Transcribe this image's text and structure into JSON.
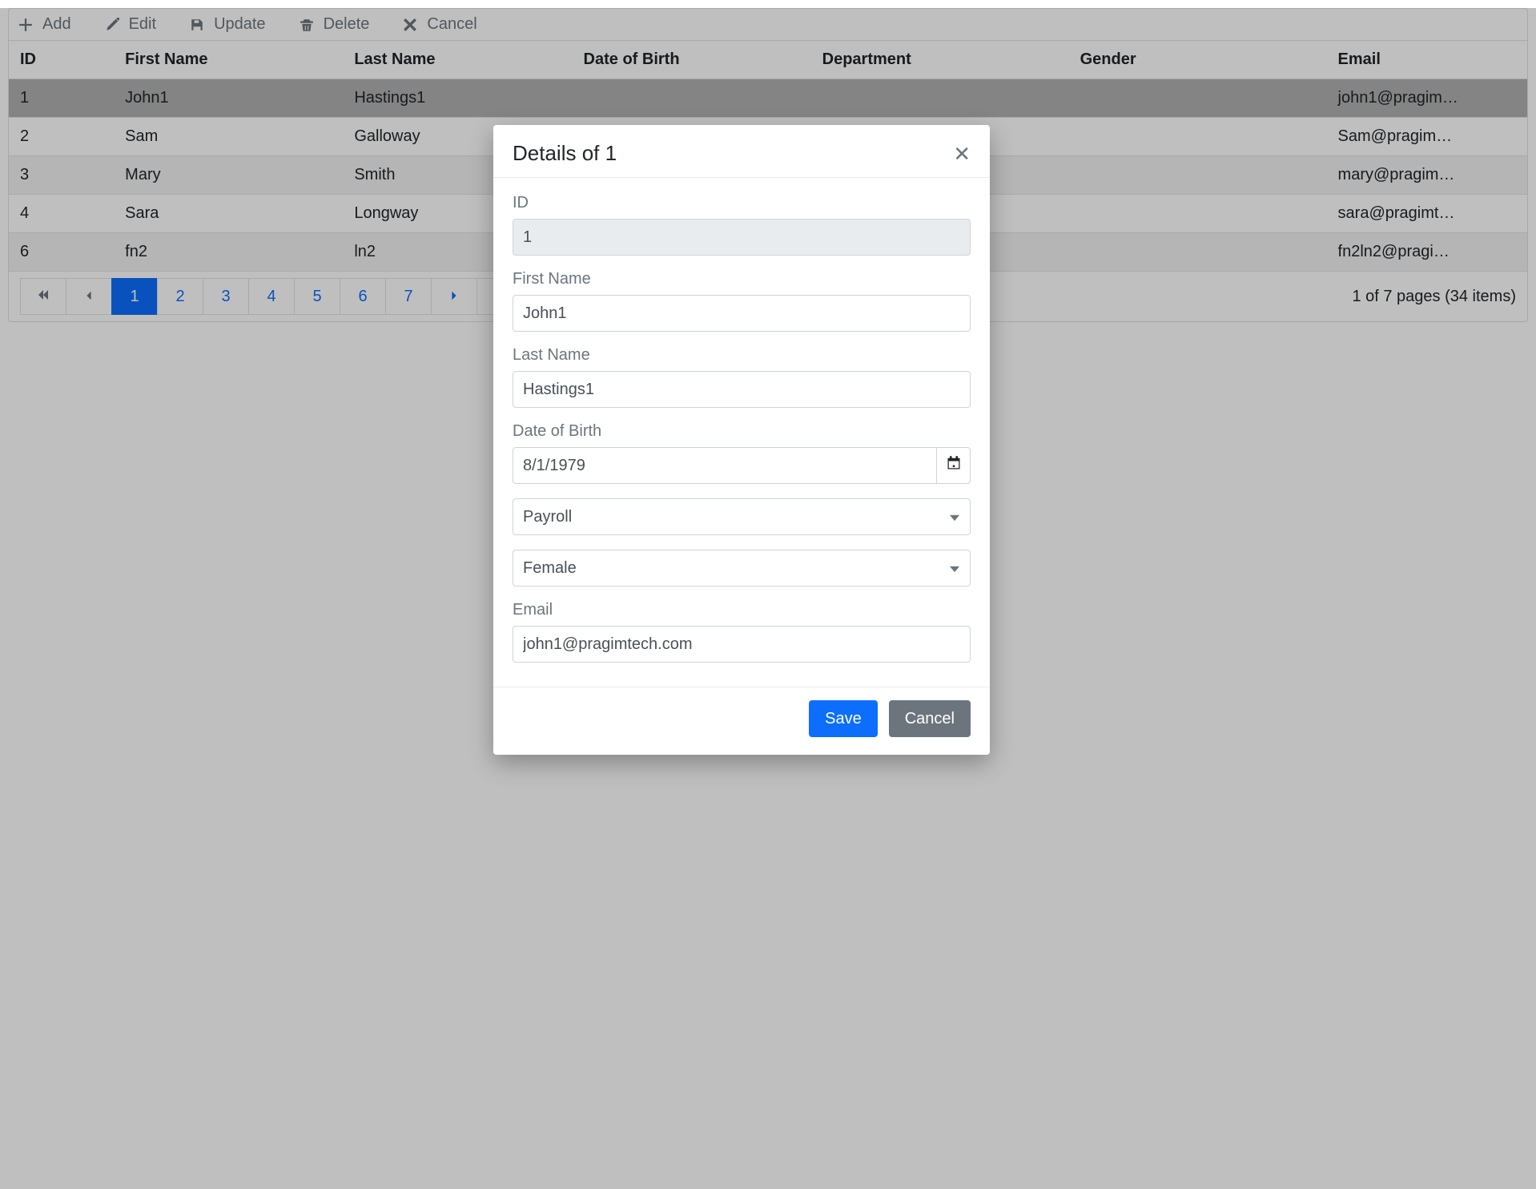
{
  "toolbar": {
    "add": "Add",
    "edit": "Edit",
    "update": "Update",
    "delete": "Delete",
    "cancel": "Cancel"
  },
  "columns": {
    "id": "ID",
    "first": "First Name",
    "last": "Last Name",
    "dob": "Date of Birth",
    "dept": "Department",
    "gender": "Gender",
    "email": "Email"
  },
  "rows": [
    {
      "id": "1",
      "first": "John1",
      "last": "Hastings1",
      "email": "john1@pragim…"
    },
    {
      "id": "2",
      "first": "Sam",
      "last": "Galloway",
      "email": "Sam@pragim…"
    },
    {
      "id": "3",
      "first": "Mary",
      "last": "Smith",
      "email": "mary@pragim…"
    },
    {
      "id": "4",
      "first": "Sara",
      "last": "Longway",
      "email": "sara@pragimt…"
    },
    {
      "id": "6",
      "first": "fn2",
      "last": "ln2",
      "email": "fn2ln2@pragi…"
    }
  ],
  "pager": {
    "pages": [
      "1",
      "2",
      "3",
      "4",
      "5",
      "6",
      "7"
    ],
    "active": "1",
    "info": "1 of 7 pages (34 items)"
  },
  "dialog": {
    "title": "Details of 1",
    "labels": {
      "id": "ID",
      "first": "First Name",
      "last": "Last Name",
      "dob": "Date of Birth",
      "email": "Email"
    },
    "values": {
      "id": "1",
      "first": "John1",
      "last": "Hastings1",
      "dob": "8/1/1979",
      "dept": "Payroll",
      "gender": "Female",
      "email": "john1@pragimtech.com"
    },
    "buttons": {
      "save": "Save",
      "cancel": "Cancel"
    }
  }
}
